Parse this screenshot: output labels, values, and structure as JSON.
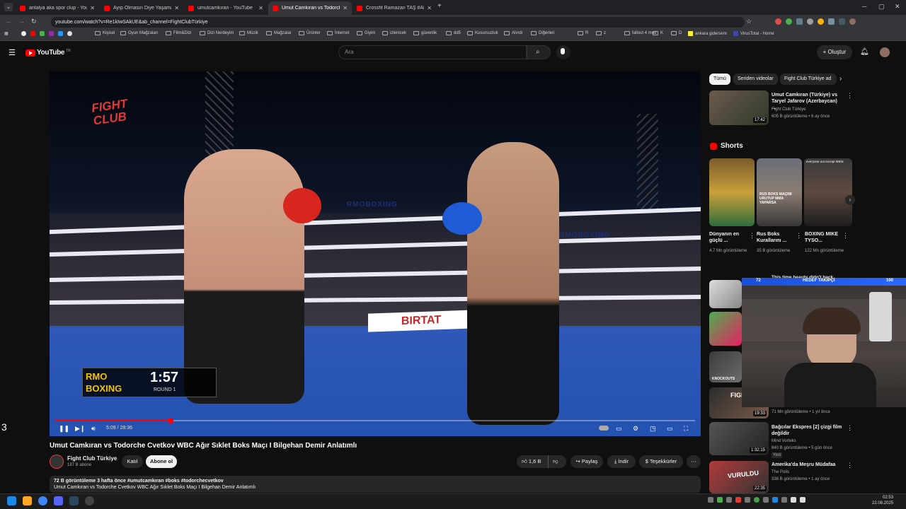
{
  "browser": {
    "tabs": [
      {
        "title": "antalya aka spor clup - YouTube",
        "active": false
      },
      {
        "title": "Ayıp Olmasın Diye Yaşamak! - Y",
        "active": false
      },
      {
        "title": "umutcamkıran - YouTube",
        "active": false
      },
      {
        "title": "Umut Camkıran vs Todorche",
        "active": true
      },
      {
        "title": "Crossfit Ramazan TAŞ #AKATA",
        "active": false
      }
    ],
    "new_tab": "+",
    "url": "youtube.com/watch?v=Re1kIwSAkUE&ab_channel=FightClubTürkiye",
    "bookmarks": [
      "Kişisel",
      "Oyun Mağzaları",
      "Film&Dizi",
      "Dizi Nerdeyim",
      "Müzik",
      "Mağzalar",
      "Ürünler",
      "İnternet",
      "Giyim",
      "izlenicek",
      "güvenlik",
      "dd5",
      "Kusursuzluk",
      "Alındı",
      "Diğerleri",
      "R",
      "z",
      "fallout 4 mod",
      "K",
      "D",
      "ankara gidersem",
      "VirusTotal - Home"
    ]
  },
  "youtube": {
    "logo_text": "YouTube",
    "logo_sup": "TR",
    "search_placeholder": "Ara",
    "create_label": "Oluştur"
  },
  "video": {
    "overlay_brand": "FIGHT CLUB",
    "scoreboard_left": "RMO BOXING",
    "scoreboard_time": "1:57",
    "scoreboard_round": "ROUND 1",
    "banner_text": "RMOBOXING",
    "sponsor": "BIRTAT",
    "time_label": "5:09 / 28:36",
    "progress_fraction": 0.18,
    "title": "Umut Camkıran vs Todorche Cvetkov WBC Ağır Sıklet Boks Maçı I Bilgehan Demir Anlatımlı",
    "channel": "Fight Club Türkiye",
    "subscribers": "187 B abone",
    "join_label": "Katıl",
    "subscribe_label": "Abone ol",
    "likes": "1,6 B",
    "share_label": "Paylaş",
    "download_label": "İndir",
    "thanks_label": "Teşekkürler",
    "description_meta": "72 B görüntüleme  3 hafta önce  #umutcamkıran #boks #todorchecvetkov",
    "description_text": "Umut Camkıran vs Todorche Cvetkov WBC Ağır Sıklet Boks Maçı I Bilgehan Demir Anlatımlı"
  },
  "side_number": "3",
  "sidebar": {
    "chips": [
      "Tümü",
      "Seriden videolar",
      "Fight Club Türkiye ad"
    ],
    "first_video": {
      "title": "Umut Camkıran (Türkiye) vs Taryel Jafarov (Azerbaycan) ...",
      "channel": "Fight Club Türkiye",
      "meta": "605 B görüntüleme • 6 ay önce",
      "duration": "17:42"
    },
    "shorts_title": "Shorts",
    "shorts": [
      {
        "title": "Dünyanın en güçlü ...",
        "views": "4,7 Mn görüntüleme",
        "thumb_text": ""
      },
      {
        "title": "Rus Boks Kurallarını ...",
        "views": "35 B görüntüleme",
        "thumb_text": "RUS BOKS MAÇINI URUTUP MMA YAPARSA"
      },
      {
        "title": "BOXING MIKE TYSO...",
        "views": "122 Mn görüntüleme",
        "thumb_text": "everyone out except MIKE"
      }
    ],
    "more_videos": [
      {
        "title": "This time beauty didn't back",
        "meta": "",
        "duration": ""
      },
      {
        "title": "",
        "meta": "",
        "duration": ""
      },
      {
        "title": "",
        "meta": "",
        "duration": ""
      },
      {
        "title": "",
        "meta": "71 Mn görüntüleme • 1 yıl önce",
        "duration": "19:33",
        "thumb_text": "FIGHT"
      },
      {
        "title": "Bağcılar Ekspres [2] çizgi film değildir",
        "channel": "Mind Vorteks",
        "meta": "840 B görüntüleme • 5 gün önce",
        "badge": "Yeni",
        "duration": "1:32:15"
      },
      {
        "title": "Amerika'da Meşru Müdafaa",
        "channel": "The Polis",
        "meta": "338 B görüntüleme • 1 ay önce",
        "duration": "22:35",
        "thumb_text": "VURULDU"
      }
    ]
  },
  "webcam": {
    "left_count": "72",
    "bar_label": "HEDEF TAKİPÇİ",
    "right_count": "100"
  },
  "taskbar": {
    "time": "02:53",
    "date": "22.08.2025"
  },
  "colors": {
    "accent": "#ff0000",
    "bg": "#0f0f0f",
    "chip": "#272727"
  }
}
